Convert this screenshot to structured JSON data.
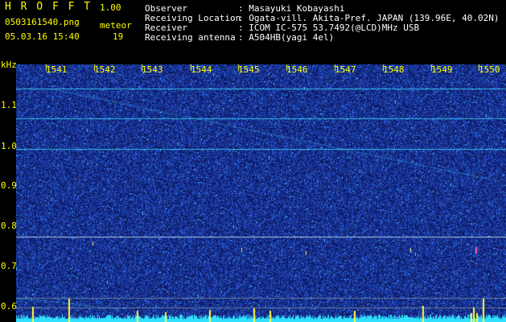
{
  "header": {
    "app_name": "H R O F F T",
    "version": "1.00",
    "filename": "0503161540.png",
    "meteor_label": "meteor",
    "datetime": "05.03.16 15:40",
    "meteor_count": "19",
    "observer_label": "Observer",
    "observer_value": ": Masayuki Kobayashi",
    "location_label": "Receiving Location",
    "location_value": ": Ogata-vill. Akita-Pref. JAPAN (139.96E, 40.02N)",
    "receiver_label": "Receiver",
    "receiver_value": ": ICOM IC-575 53.7492(@LCD)MHz USB",
    "antenna_label": "Receiving antenna",
    "antenna_value": ": A504HB(yagi 4el)"
  },
  "axes": {
    "y_unit": "kHz",
    "y_ticks": [
      "1.1",
      "1.0",
      "0.9",
      "0.8",
      "0.7",
      "0.6"
    ],
    "x_ticks": [
      "1541",
      "1542",
      "1543",
      "1544",
      "1545",
      "1546",
      "1547",
      "1548",
      "1549",
      "1550"
    ]
  },
  "colors": {
    "label": "#ffff00",
    "text": "#ffffff",
    "background": "#0a0a60",
    "noise": "#2850d0",
    "signal": "#40e0ff"
  }
}
